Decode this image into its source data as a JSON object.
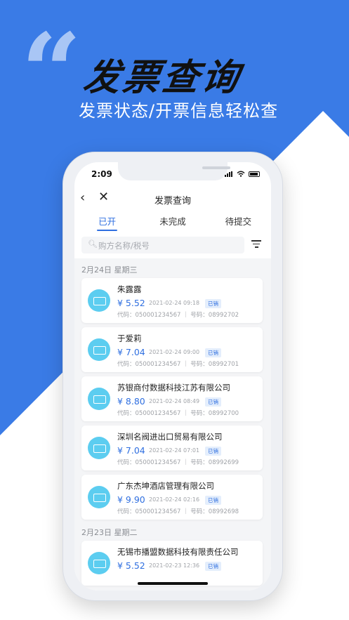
{
  "promo": {
    "quote": "“",
    "headline": "发票查询",
    "subheadline": "发票状态/开票信息轻松查"
  },
  "status_bar": {
    "time": "2:09"
  },
  "nav": {
    "title": "发票查询"
  },
  "tabs": [
    {
      "label": "已开",
      "active": true
    },
    {
      "label": "未完成",
      "active": false
    },
    {
      "label": "待提交",
      "active": false
    }
  ],
  "search": {
    "placeholder": "购方名称/税号"
  },
  "groups": [
    {
      "date": "2月24日 星期三",
      "invoices": [
        {
          "name": "朱露露",
          "amount": "¥ 5.52",
          "time": "2021-02-24 09:18",
          "status": "已销",
          "meta": "代码：050001234567 ｜ 号码：08992702"
        },
        {
          "name": "于爱莉",
          "amount": "¥ 7.04",
          "time": "2021-02-24 09:00",
          "status": "已销",
          "meta": "代码：050001234567 ｜ 号码：08992701"
        },
        {
          "name": "苏银商付数据科技江苏有限公司",
          "amount": "¥ 8.80",
          "time": "2021-02-24 08:49",
          "status": "已销",
          "meta": "代码：050001234567 ｜ 号码：08992700"
        },
        {
          "name": "深圳名阀进出口贸易有限公司",
          "amount": "¥ 7.04",
          "time": "2021-02-24 07:01",
          "status": "已销",
          "meta": "代码：050001234567 ｜ 号码：08992699"
        },
        {
          "name": "广东杰坤酒店管理有限公司",
          "amount": "¥ 9.90",
          "time": "2021-02-24 02:16",
          "status": "已销",
          "meta": "代码：050001234567 ｜ 号码：08992698"
        }
      ]
    },
    {
      "date": "2月23日 星期二",
      "invoices": [
        {
          "name": "无锡市播盟数据科技有限责任公司",
          "amount": "¥ 5.52",
          "time": "2021-02-23 12:36",
          "status": "已销",
          "meta": ""
        }
      ]
    }
  ],
  "colors": {
    "brand_blue": "#3a7be6",
    "accent": "#2f6fe0",
    "icon_cyan": "#5ccdf0"
  }
}
